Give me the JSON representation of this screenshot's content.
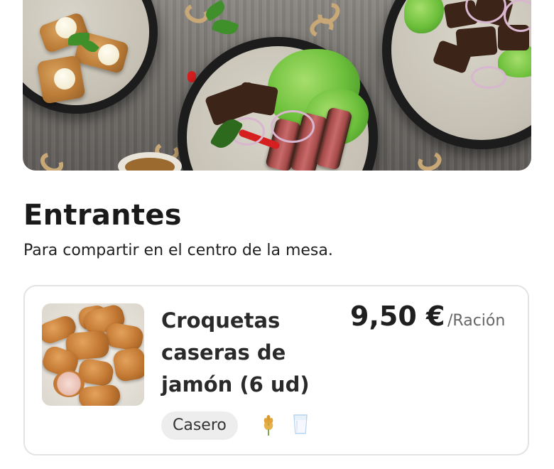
{
  "section": {
    "title": "Entrantes",
    "subtitle": "Para compartir en el centro de la mesa."
  },
  "products": [
    {
      "name": "Croquetas caseras de jamón (6 ud)",
      "price": "9,50 €",
      "unit": "/Ración",
      "tag": "Casero",
      "allergen_icons": [
        "gluten-wheat-icon",
        "milk-glass-icon"
      ]
    }
  ],
  "colors": {
    "card_border": "#e3e3e3",
    "tag_background": "#ededed",
    "unit_text": "#666666",
    "gluten_icon": "#e0a43a",
    "milk_icon": "#b8d6ee"
  }
}
